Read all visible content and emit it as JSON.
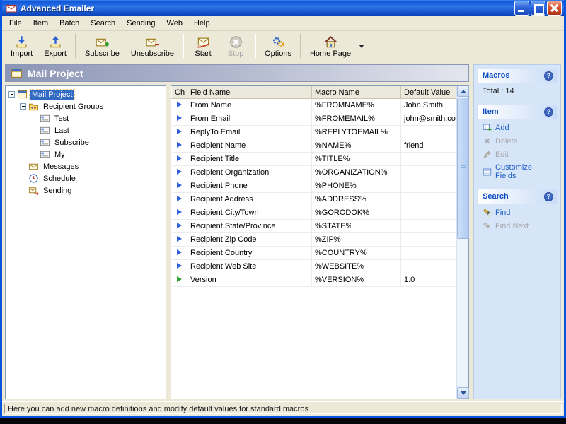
{
  "window": {
    "title": "Advanced Emailer",
    "status_text": "Here you can add new macro definitions and modify default values for standard macros"
  },
  "menu": {
    "items": [
      "File",
      "Item",
      "Batch",
      "Search",
      "Sending",
      "Web",
      "Help"
    ]
  },
  "toolbar": {
    "buttons": [
      {
        "label": "Import",
        "enabled": true
      },
      {
        "label": "Export",
        "enabled": true
      },
      {
        "label": "Subscribe",
        "enabled": true
      },
      {
        "label": "Unsubscribe",
        "enabled": true
      },
      {
        "label": "Start",
        "enabled": true
      },
      {
        "label": "Stop",
        "enabled": false
      },
      {
        "label": "Options",
        "enabled": true
      },
      {
        "label": "Home Page",
        "enabled": true
      }
    ]
  },
  "project_header": {
    "title": "Mail Project"
  },
  "tree": {
    "items": [
      {
        "label": "Mail Project",
        "level": 0,
        "selected": true
      },
      {
        "label": "Recipient Groups",
        "level": 1,
        "selected": false
      },
      {
        "label": "Test",
        "level": 2,
        "selected": false
      },
      {
        "label": "Last",
        "level": 2,
        "selected": false
      },
      {
        "label": "Subscribe",
        "level": 2,
        "selected": false
      },
      {
        "label": "My",
        "level": 2,
        "selected": false
      },
      {
        "label": "Messages",
        "level": 1,
        "selected": false
      },
      {
        "label": "Schedule",
        "level": 1,
        "selected": false
      },
      {
        "label": "Sending",
        "level": 1,
        "selected": false
      }
    ]
  },
  "table": {
    "columns": [
      "Ch",
      "Field Name",
      "Macro Name",
      "Default Value"
    ],
    "rows": [
      {
        "field": "From Name",
        "macro": "%FROMNAME%",
        "value": "John Smith"
      },
      {
        "field": "From Email",
        "macro": "%FROMEMAIL%",
        "value": "john@smith.com"
      },
      {
        "field": "ReplyTo Email",
        "macro": "%REPLYTOEMAIL%",
        "value": ""
      },
      {
        "field": "Recipient Name",
        "macro": "%NAME%",
        "value": "friend"
      },
      {
        "field": "Recipient Title",
        "macro": "%TITLE%",
        "value": ""
      },
      {
        "field": "Recipient Organization",
        "macro": "%ORGANIZATION%",
        "value": ""
      },
      {
        "field": "Recipient Phone",
        "macro": "%PHONE%",
        "value": ""
      },
      {
        "field": "Recipient Address",
        "macro": "%ADDRESS%",
        "value": ""
      },
      {
        "field": "Recipient City/Town",
        "macro": "%GORODOK%",
        "value": ""
      },
      {
        "field": "Recipient State/Province",
        "macro": "%STATE%",
        "value": ""
      },
      {
        "field": "Recipient Zip Code",
        "macro": "%ZIP%",
        "value": ""
      },
      {
        "field": "Recipient Country",
        "macro": "%COUNTRY%",
        "value": ""
      },
      {
        "field": "Recipient Web Site",
        "macro": "%WEBSITE%",
        "value": ""
      },
      {
        "field": "Version",
        "macro": "%VERSION%",
        "value": "1.0"
      }
    ]
  },
  "sidebar": {
    "help_glyph": "?",
    "sections": [
      {
        "title": "Macros",
        "items": [
          {
            "label": "Total : 14",
            "enabled": true
          }
        ]
      },
      {
        "title": "Item",
        "items": [
          {
            "label": "Add",
            "enabled": true
          },
          {
            "label": "Delete",
            "enabled": false
          },
          {
            "label": "Edit",
            "enabled": false
          },
          {
            "label": "Customize Fields",
            "enabled": true
          }
        ]
      },
      {
        "title": "Search",
        "items": [
          {
            "label": "Find",
            "enabled": true
          },
          {
            "label": "Find Next",
            "enabled": false
          }
        ]
      }
    ]
  },
  "colors": {
    "titlebar_blue": "#0855DD",
    "selection_blue": "#316AC5",
    "sidebar_bg": "#D6E6F8",
    "link_blue": "#215DC6",
    "disabled_gray": "#A7A6AA",
    "macro_icon_blue": "#2E5EDB",
    "macro_icon_green": "#2FA02F"
  }
}
